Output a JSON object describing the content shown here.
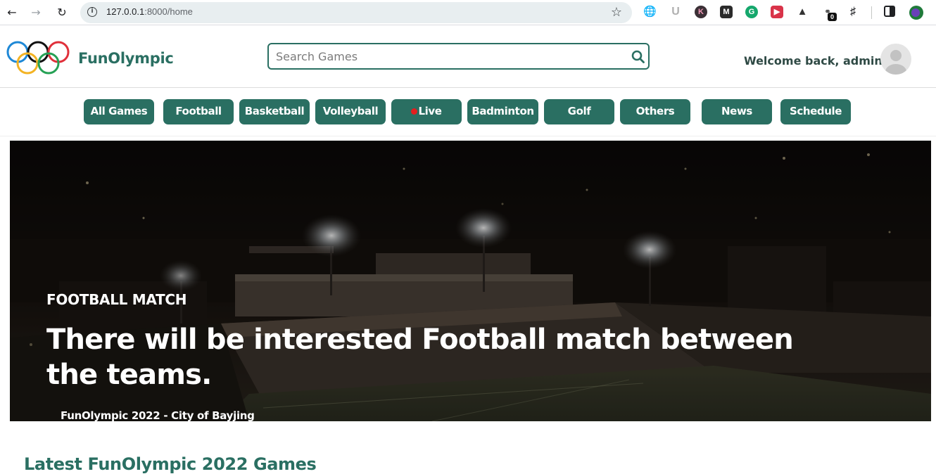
{
  "browser": {
    "url_host": "127.0.0.1",
    "url_rest": ":8000/home",
    "extension_badge": "0"
  },
  "header": {
    "brand": "FunOlympic",
    "search_placeholder": "Search Games",
    "welcome": "Welcome back, admin"
  },
  "nav": {
    "items": [
      {
        "label": "All Games"
      },
      {
        "label": "Football"
      },
      {
        "label": "Basketball"
      },
      {
        "label": "Volleyball"
      },
      {
        "label": "Live"
      },
      {
        "label": "Badminton"
      },
      {
        "label": "Golf"
      },
      {
        "label": "Others"
      },
      {
        "label": "News"
      },
      {
        "label": "Schedule"
      }
    ]
  },
  "hero": {
    "tag": "FOOTBALL MATCH",
    "title": "There will be interested Football match between the teams.",
    "caption": "FunOlympic 2022 - City of Bayjing"
  },
  "section": {
    "title": "Latest FunOlympic 2022 Games"
  },
  "colors": {
    "brand": "#2a6f62",
    "live_dot": "#e41e1e"
  }
}
